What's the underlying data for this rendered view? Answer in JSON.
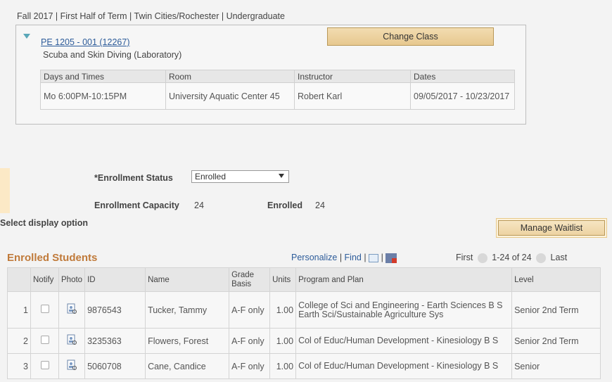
{
  "header": {
    "term_line": "Fall 2017 | First Half of Term | Twin Cities/Rochester | Undergraduate"
  },
  "class_info": {
    "link": "PE 1205 - 001 (12267)",
    "subtitle": "Scuba and Skin Diving (Laboratory)",
    "change_button": "Change Class",
    "meeting_headers": [
      "Days and Times",
      "Room",
      "Instructor",
      "Dates"
    ],
    "meeting": {
      "days_times": "Mo 6:00PM-10:15PM",
      "room": "University Aquatic Center 45",
      "instructor": "Robert Karl",
      "dates": "09/05/2017 - 10/23/2017"
    }
  },
  "enrollment": {
    "status_label": "*Enrollment Status",
    "status_value": "Enrolled",
    "capacity_label": "Enrollment Capacity",
    "capacity_value": "24",
    "enrolled_label": "Enrolled",
    "enrolled_value": "24",
    "display_option_label": "Select display option",
    "manage_button": "Manage Waitlist"
  },
  "grid": {
    "title": "Enrolled Students",
    "personalize": "Personalize",
    "find": "Find",
    "first": "First",
    "range": "1-24 of 24",
    "last": "Last",
    "columns": [
      "Notify",
      "Photo",
      "ID",
      "Name",
      "Grade Basis",
      "Units",
      "Program and Plan",
      "Level"
    ],
    "rows": [
      {
        "n": "1",
        "id": "9876543",
        "name": "Tucker, Tammy",
        "grade": "A-F only",
        "units": "1.00",
        "program": "College of Sci and Engineering - Earth Sciences B S Earth Sci/Sustainable Agriculture Sys",
        "level": "Senior 2nd Term"
      },
      {
        "n": "2",
        "id": "3235363",
        "name": "Flowers, Forest",
        "grade": "A-F only",
        "units": "1.00",
        "program": "Col of Educ/Human Development - Kinesiology B S",
        "level": "Senior 2nd Term"
      },
      {
        "n": "3",
        "id": "5060708",
        "name": "Cane, Candice",
        "grade": "A-F only",
        "units": "1.00",
        "program": "Col of Educ/Human Development - Kinesiology B S",
        "level": "Senior"
      }
    ]
  }
}
